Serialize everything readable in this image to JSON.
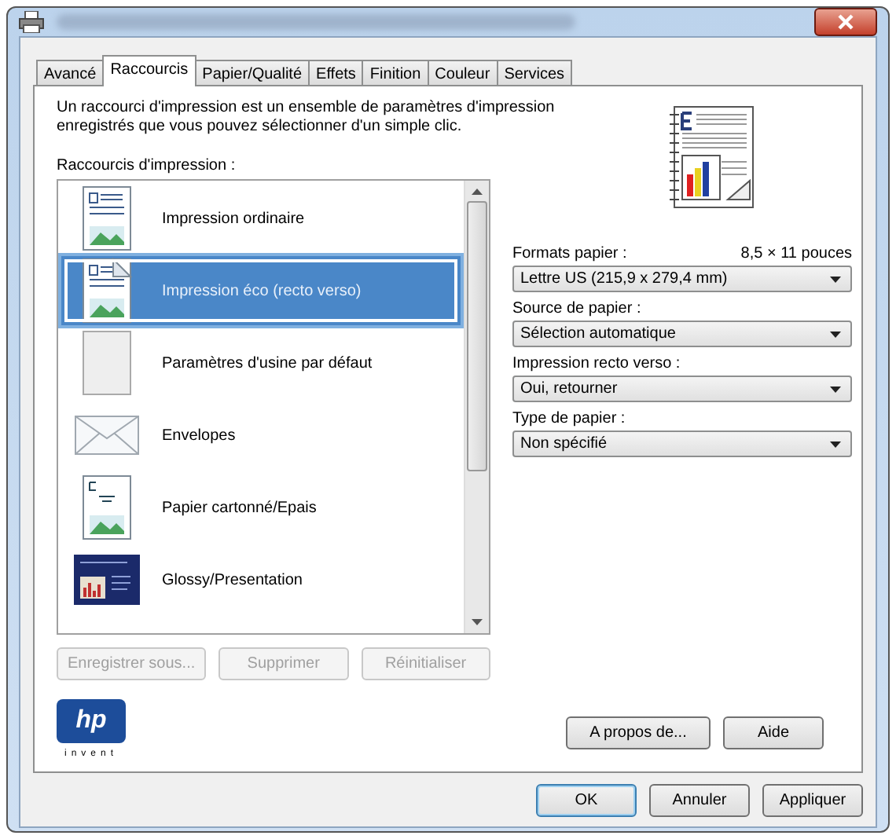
{
  "tabs": [
    {
      "label": "Avancé",
      "selected": false
    },
    {
      "label": "Raccourcis",
      "selected": true
    },
    {
      "label": "Papier/Qualité",
      "selected": false
    },
    {
      "label": "Effets",
      "selected": false
    },
    {
      "label": "Finition",
      "selected": false
    },
    {
      "label": "Couleur",
      "selected": false
    },
    {
      "label": "Services",
      "selected": false
    }
  ],
  "description": "Un raccourci d'impression est un ensemble de paramètres d'impression enregistrés que vous pouvez sélectionner d'un simple clic.",
  "shortcuts_label": "Raccourcis d'impression :",
  "shortcuts": [
    {
      "label": "Impression ordinaire",
      "kind": "document",
      "selected": false
    },
    {
      "label": "Impression éco (recto verso)",
      "kind": "duplex",
      "selected": true
    },
    {
      "label": "Paramètres d'usine par défaut",
      "kind": "blank",
      "selected": false
    },
    {
      "label": "Envelopes",
      "kind": "envelope",
      "selected": false
    },
    {
      "label": "Papier cartonné/Epais",
      "kind": "cardstock",
      "selected": false
    },
    {
      "label": "Glossy/Presentation",
      "kind": "presentation",
      "selected": false
    }
  ],
  "list_buttons": [
    {
      "label": "Enregistrer sous...",
      "disabled": true
    },
    {
      "label": "Supprimer",
      "disabled": true
    },
    {
      "label": "Réinitialiser",
      "disabled": true
    }
  ],
  "settings": [
    {
      "label": "Formats papier :",
      "note": "8,5 × 11 pouces",
      "value": "Lettre US (215,9 x 279,4 mm)"
    },
    {
      "label": "Source de papier :",
      "value": "Sélection automatique"
    },
    {
      "label": "Impression recto verso :",
      "value": "Oui, retourner"
    },
    {
      "label": "Type de papier :",
      "value": "Non spécifié"
    }
  ],
  "logo": {
    "mark": "hp",
    "tagline": "invent"
  },
  "panel_buttons": [
    "A propos de...",
    "Aide"
  ],
  "dialog_buttons": [
    {
      "label": "OK",
      "default": true
    },
    {
      "label": "Annuler",
      "default": false
    },
    {
      "label": "Appliquer",
      "default": false
    }
  ]
}
